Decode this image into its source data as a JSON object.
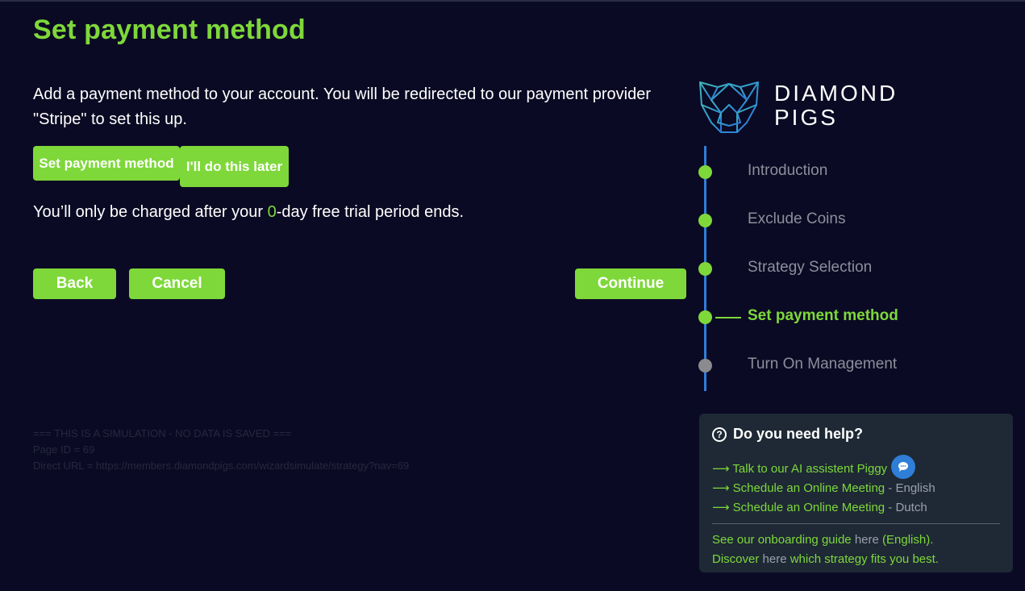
{
  "page": {
    "title": "Set payment method",
    "intro": "Add a payment method to your account. You will be redirected to our payment provider \"Stripe\" to set this up."
  },
  "actions": {
    "set_payment_label": "Set payment method",
    "later_label": "I'll do this later"
  },
  "trial": {
    "prefix": "You’ll only be charged after your ",
    "days": "0",
    "suffix": "-day free trial period ends."
  },
  "nav": {
    "back_label": "Back",
    "cancel_label": "Cancel",
    "continue_label": "Continue"
  },
  "simulation": {
    "line1": "=== THIS IS A SIMULATION - NO DATA IS SAVED ===",
    "line2": "Page ID = 69",
    "line3": "Direct URL = https://members.diamondpigs.com/wizardsimulate/strategy?nav=69"
  },
  "brand": {
    "line1": "DIAMOND",
    "line2": "PIGS",
    "logo_icon": "pig-diamond-logo-icon"
  },
  "steps": [
    {
      "label": "Introduction",
      "state": "done"
    },
    {
      "label": "Exclude Coins",
      "state": "done"
    },
    {
      "label": "Strategy Selection",
      "state": "done"
    },
    {
      "label": "Set payment method",
      "state": "active"
    },
    {
      "label": "Turn On Management",
      "state": "pending"
    }
  ],
  "help": {
    "title": "Do you need help?",
    "ai_link": "⟶ Talk to our AI assistent Piggy",
    "meeting_en_link": "⟶ Schedule an Online Meeting",
    "meeting_en_lang": " - English",
    "meeting_nl_link": "⟶ Schedule an Online Meeting",
    "meeting_nl_lang": " - Dutch",
    "guide_prefix": "See our onboarding guide ",
    "guide_here": "here",
    "guide_suffix": " (English).",
    "discover_prefix": "Discover ",
    "discover_here": "here",
    "discover_suffix": " which strategy fits you best."
  },
  "colors": {
    "background": "#0b0a24",
    "accent": "#7ed83a",
    "step_line": "#2f7ed8",
    "help_bg": "#1e2935"
  }
}
